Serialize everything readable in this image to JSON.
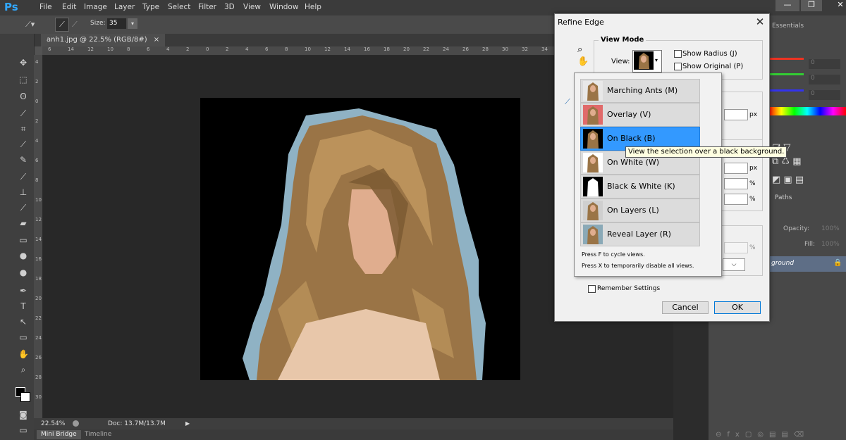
{
  "app": {
    "logo": "Ps"
  },
  "menu": [
    "File",
    "Edit",
    "Image",
    "Layer",
    "Type",
    "Select",
    "Filter",
    "3D",
    "View",
    "Window",
    "Help"
  ],
  "options_bar": {
    "size_label": "Size:",
    "size_value": "35"
  },
  "document": {
    "tab_title": "anh1.jpg @ 22.5% (RGB/8#)",
    "tab_close": "×"
  },
  "ruler": {
    "h_ticks": [
      "6",
      "14",
      "12",
      "10",
      "8",
      "6",
      "4",
      "2",
      "0",
      "2",
      "4",
      "6",
      "8",
      "10",
      "12",
      "14",
      "16",
      "18",
      "20",
      "22",
      "24",
      "26",
      "28",
      "30",
      "32",
      "34"
    ],
    "v_ticks": [
      "4",
      "2",
      "0",
      "2",
      "4",
      "6",
      "8",
      "10",
      "12",
      "14",
      "16",
      "18",
      "20",
      "22",
      "24",
      "26",
      "28",
      "30"
    ]
  },
  "status": {
    "zoom": "22.54%",
    "doc": "Doc: 13.7M/13.7M"
  },
  "bottom_tabs": [
    "Mini Bridge",
    "Timeline"
  ],
  "right_panel": {
    "workspace": "Essentials",
    "paths_tab": "Paths",
    "opacity_label": "Opacity:",
    "opacity_value": "100%",
    "fill_label": "Fill:",
    "fill_value": "100%",
    "layer_name": "ground",
    "color_values": [
      "0",
      "0",
      "0"
    ]
  },
  "dialog": {
    "title": "Refine Edge",
    "close": "✕",
    "view_mode_label": "View Mode",
    "view_label": "View:",
    "show_radius": "Show Radius (J)",
    "show_original": "Show Original (P)",
    "unit_px_1": "px",
    "unit_px_2": "px",
    "unit_pct_1": "%",
    "unit_pct_2": "%",
    "unit_pct_3": "%",
    "remember_settings": "Remember Settings",
    "cancel": "Cancel",
    "ok": "OK"
  },
  "view_options": [
    {
      "label": "Marching Ants (M)",
      "thumb_bg": "#e8e8e8",
      "selected": false
    },
    {
      "label": "Overlay (V)",
      "thumb_bg": "#e06a6a",
      "selected": false
    },
    {
      "label": "On Black (B)",
      "thumb_bg": "#000000",
      "selected": true
    },
    {
      "label": "On White (W)",
      "thumb_bg": "#ffffff",
      "selected": false
    },
    {
      "label": "Black & White (K)",
      "thumb_bg": "#000000",
      "selected": false
    },
    {
      "label": "On Layers (L)",
      "thumb_bg": "#cfcfcf",
      "selected": false
    },
    {
      "label": "Reveal Layer (R)",
      "thumb_bg": "#8aa9b7",
      "selected": false
    }
  ],
  "dropdown_hints": {
    "hint1": "Press F to cycle views.",
    "hint2": "Press X to temporarily disable all views."
  },
  "tooltip": "View the selection over a black background.",
  "colors": {
    "accent": "#3399ff",
    "ps_blue": "#31a8ff",
    "halo": "#8fb2c4",
    "hair": "#9a7446"
  }
}
